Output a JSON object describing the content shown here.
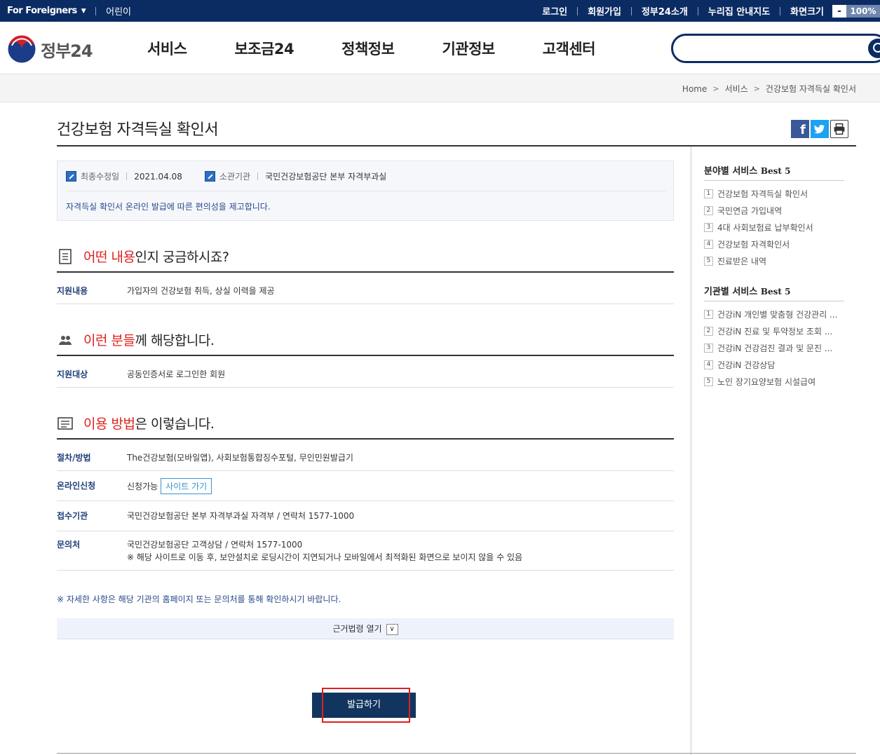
{
  "topbar": {
    "foreigners": "For Foreigners",
    "kids": "어린이",
    "login": "로그인",
    "signup": "회원가입",
    "intro": "정부24소개",
    "guide": "누리집 안내지도",
    "screen_size": "화면크기",
    "zoom_minus": "-",
    "zoom_level": "100%"
  },
  "header": {
    "logo_text": "정부24",
    "nav": [
      "서비스",
      "보조금24",
      "정책정보",
      "기관정보",
      "고객센터"
    ],
    "search_placeholder": ""
  },
  "breadcrumb": [
    "Home",
    "서비스",
    "건강보험 자격득실 확인서"
  ],
  "page": {
    "title": "건강보험 자격득실 확인서"
  },
  "info": {
    "modified_label": "최종수정일",
    "modified_value": "2021.04.08",
    "agency_label": "소관기관",
    "agency_value": "국민건강보험공단 본부 자격부과실",
    "description": "자격득실 확인서 온라인 발급에 따른 편의성을 제고합니다."
  },
  "section1": {
    "title_red": "어떤 내용",
    "title_rest": "인지 궁금하시죠?",
    "rows": [
      {
        "label": "지원내용",
        "text": "가입자의 건강보험 취득, 상실 이력을 제공"
      }
    ]
  },
  "section2": {
    "title_red": "이런 분들",
    "title_rest": "께 해당합니다.",
    "rows": [
      {
        "label": "지원대상",
        "text": "공동인증서로 로그인한 회원"
      }
    ]
  },
  "section3": {
    "title_red": "이용 방법",
    "title_rest": "은 이렇습니다.",
    "procedure_label": "절차/방법",
    "procedure_text": "The건강보험(모바일앱), 사회보험통합징수포털, 무인민원발급기",
    "online_label": "온라인신청",
    "online_text": "신청가능",
    "site_button": "사이트 가기",
    "office_label": "접수기관",
    "office_text": "국민건강보험공단 본부 자격부과실 자격부 / 연락처 1577-1000",
    "contact_label": "문의처",
    "contact_text": "국민건강보험공단 고객상담 / 연락처 1577-1000",
    "contact_note": "※ 해당 사이트로 이동 후, 보안설치로 로딩시간이 지연되거나 모바일에서 최적화된 화면으로 보이지 않을 수 있음"
  },
  "note": "※ 자세한 사항은 해당 기관의 홈페이지 또는 문의처를 통해 확인하시기 바랍니다.",
  "law_toggle": "근거법령 열기",
  "issue_button": "발급하기",
  "sidebar": {
    "best_field_title_ko": "분야별 서비스",
    "best_field_title_en": "Best 5",
    "best_field": [
      "건강보험 자격득실 확인서",
      "국민연금 가입내역",
      "4대 사회보험료 납부확인서",
      "건강보험 자격확인서",
      "진료받은 내역"
    ],
    "best_agency_title_ko": "기관별 서비스",
    "best_agency_title_en": "Best 5",
    "best_agency": [
      "건강iN 개인별 맞춤형 건강관리 ...",
      "건강iN 진료 및 투약정보 조회 ...",
      "건강iN 건강검진 결과 및 문진 ...",
      "건강iN 건강상담",
      "노인 장기요양보험 시설급여"
    ]
  },
  "colors": {
    "brand_navy": "#0b2c63",
    "accent_red": "#e0201e",
    "button_navy": "#12355f"
  }
}
